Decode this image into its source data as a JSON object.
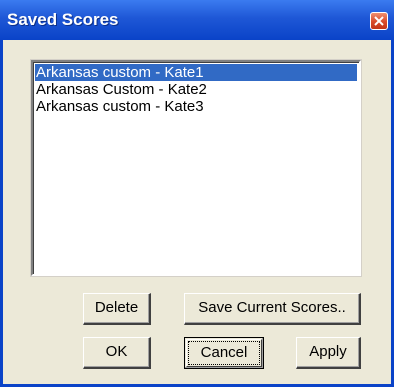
{
  "window": {
    "title": "Saved Scores",
    "close_icon": "close-icon"
  },
  "colors": {
    "titlebar": "#0a43c8",
    "selection": "#316ac5",
    "dialog_bg": "#ece9d8",
    "close_button": "#d84a2a"
  },
  "scores_list": {
    "items": [
      {
        "label": "Arkansas custom - Kate1",
        "selected": true
      },
      {
        "label": "Arkansas Custom - Kate2",
        "selected": false
      },
      {
        "label": "Arkansas custom - Kate3",
        "selected": false
      }
    ]
  },
  "buttons": {
    "delete": "Delete",
    "save_current": "Save Current Scores..",
    "ok": "OK",
    "cancel": "Cancel",
    "apply": "Apply"
  }
}
